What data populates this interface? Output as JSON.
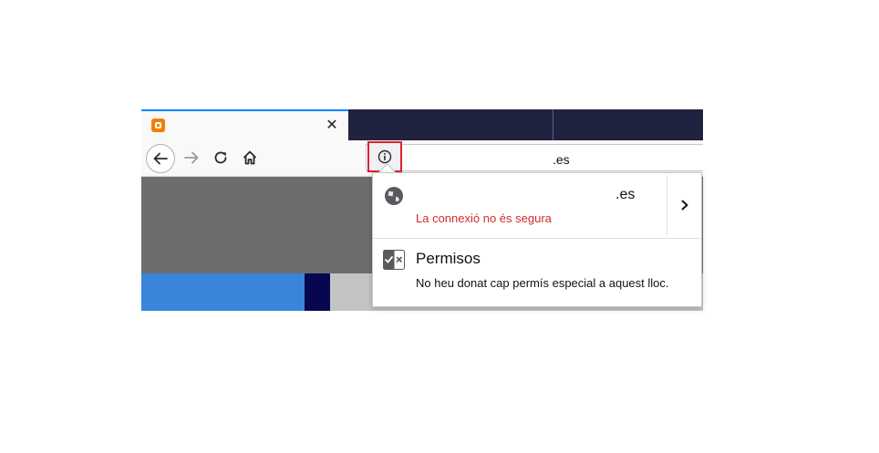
{
  "tab": {
    "favicon": "blogger-icon",
    "close_label": "✕"
  },
  "navbar": {
    "back_icon": "back-arrow-icon",
    "forward_icon": "forward-arrow-icon",
    "reload_icon": "reload-icon",
    "home_icon": "home-icon"
  },
  "urlbar": {
    "identity_icon": "info-icon",
    "url_text": ".es"
  },
  "popup": {
    "host": ".es",
    "connection_status": "La connexió no és segura",
    "permissions_title": "Permisos",
    "permissions_desc": "No heu donat cap permís especial a aquest lloc."
  },
  "colors": {
    "tabstrip": "#202340",
    "insecure_text": "#d22b2b",
    "highlight_box": "#e0232d",
    "accent": "#0a84ff"
  }
}
